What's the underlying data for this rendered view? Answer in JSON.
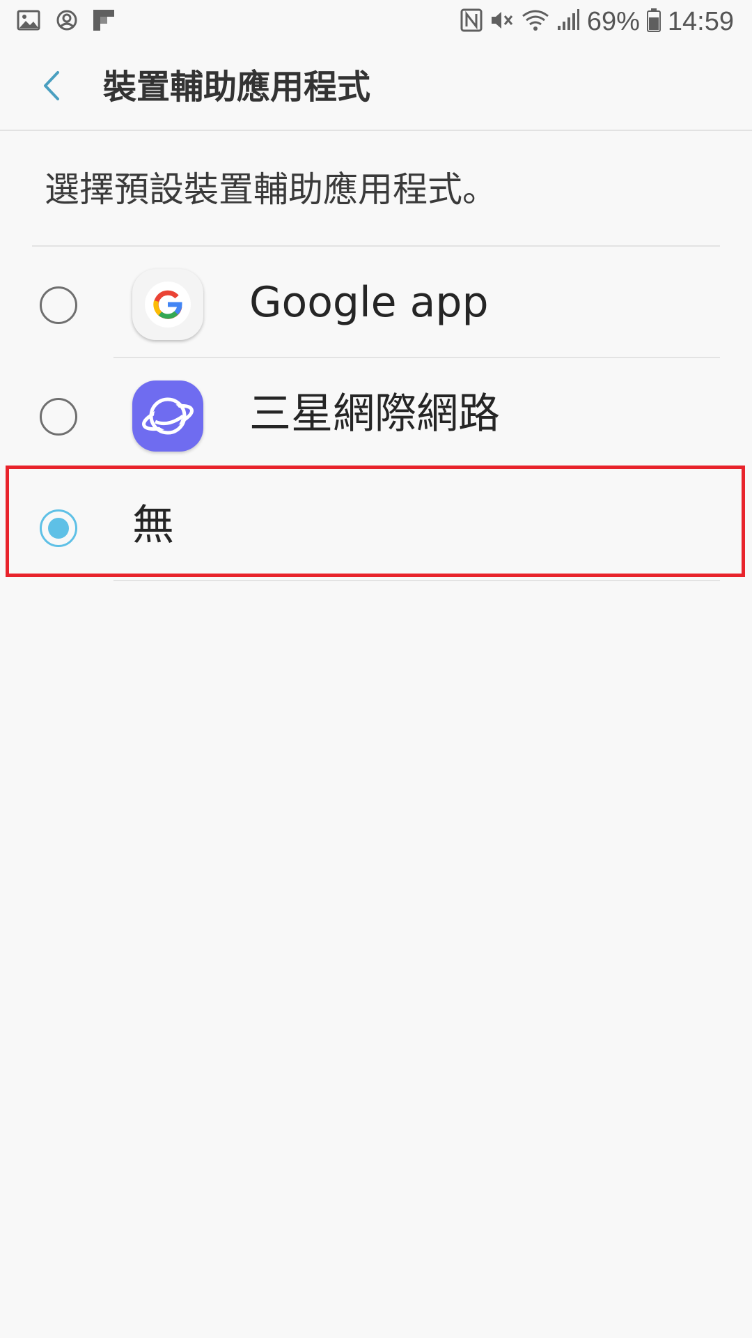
{
  "status_bar": {
    "left_icons": [
      "gallery-icon",
      "account-icon",
      "flipboard-icon"
    ],
    "right_icons": [
      "nfc-icon",
      "mute-icon",
      "wifi-icon",
      "signal-icon",
      "battery-icon"
    ],
    "battery": "69%",
    "time": "14:59"
  },
  "app_bar": {
    "title": "裝置輔助應用程式"
  },
  "description": "選擇預設裝置輔助應用程式。",
  "options": [
    {
      "label": "Google app",
      "icon": "google-icon",
      "selected": false
    },
    {
      "label": "三星網際網路",
      "icon": "samsung-internet-icon",
      "selected": false
    },
    {
      "label": "無",
      "icon": "",
      "selected": true
    }
  ],
  "colors": {
    "accent": "#5ec0e6",
    "highlight": "#e8232b",
    "samsung_icon_bg": "#6f6cf0"
  }
}
